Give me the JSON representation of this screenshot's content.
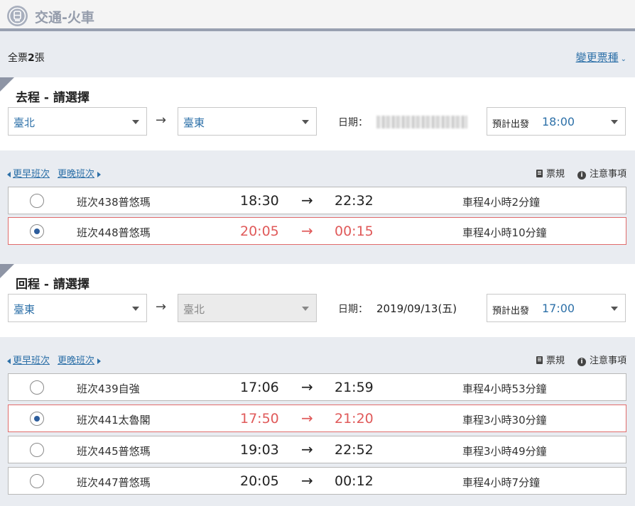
{
  "header": {
    "title": "交通-火車",
    "icon": "train-icon"
  },
  "summary": {
    "prefix": "全票",
    "count": "2",
    "suffix": "張",
    "change_link": "變更票種"
  },
  "common": {
    "date_label": "日期：",
    "depart_label": "預計出發",
    "earlier": "更早班次",
    "later": "更晚班次",
    "rules": "票規",
    "notes": "注意事項",
    "route_arrow": "→",
    "row_arrow": "→"
  },
  "outbound": {
    "title": "去程 - 請選擇",
    "from": "臺北",
    "to": "臺東",
    "date": "",
    "date_redacted": true,
    "depart_time": "18:00",
    "trains": [
      {
        "no": "班次438普悠瑪",
        "dep": "18:30",
        "arr": "22:32",
        "duration": "車程4小時2分鐘",
        "selected": false
      },
      {
        "no": "班次448普悠瑪",
        "dep": "20:05",
        "arr": "00:15",
        "duration": "車程4小時10分鐘",
        "selected": true
      }
    ]
  },
  "return": {
    "title": "回程 - 請選擇",
    "from": "臺東",
    "to": "臺北",
    "to_disabled": true,
    "date": "2019/09/13(五)",
    "depart_time": "17:00",
    "trains": [
      {
        "no": "班次439自強",
        "dep": "17:06",
        "arr": "21:59",
        "duration": "車程4小時53分鐘",
        "selected": false
      },
      {
        "no": "班次441太魯閣",
        "dep": "17:50",
        "arr": "21:20",
        "duration": "車程3小時30分鐘",
        "selected": true
      },
      {
        "no": "班次445普悠瑪",
        "dep": "19:03",
        "arr": "22:52",
        "duration": "車程3小時49分鐘",
        "selected": false
      },
      {
        "no": "班次447普悠瑪",
        "dep": "20:05",
        "arr": "00:12",
        "duration": "車程4小時7分鐘",
        "selected": false
      }
    ]
  },
  "colors": {
    "link": "#2d70a8",
    "selected": "#e05a5a",
    "header_bar": "#98a0b0",
    "background": "#e9ecf1"
  }
}
